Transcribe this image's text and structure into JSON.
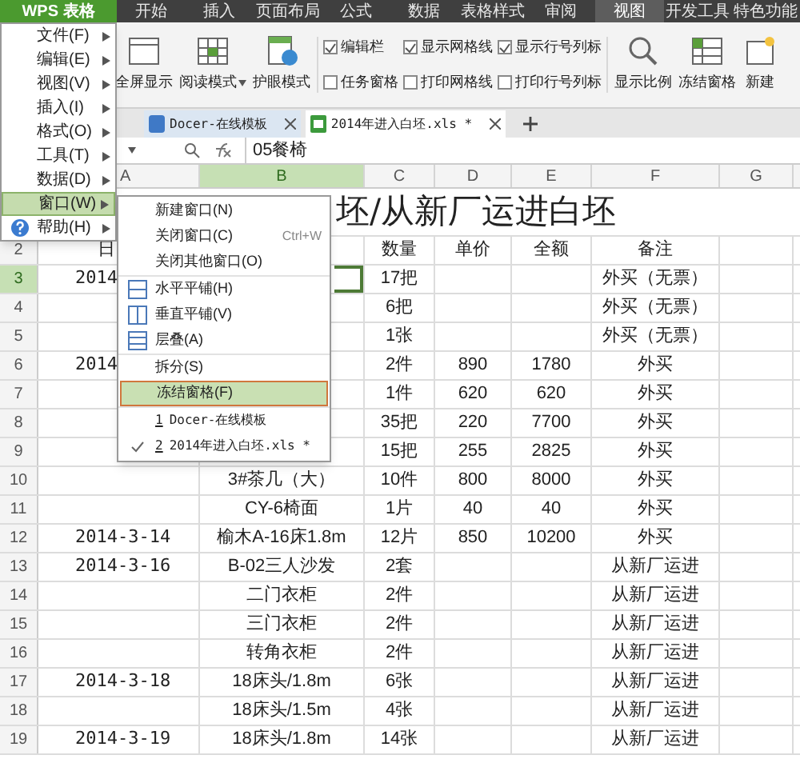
{
  "app_menu": {
    "label": "WPS 表格",
    "items": [
      {
        "label": "文件(F)",
        "kind": "plain",
        "selected": false
      },
      {
        "label": "编辑(E)",
        "kind": "plain",
        "selected": false
      },
      {
        "label": "视图(V)",
        "kind": "plain",
        "selected": false
      },
      {
        "label": "插入(I)",
        "kind": "plain",
        "selected": false
      },
      {
        "label": "格式(O)",
        "kind": "plain",
        "selected": false
      },
      {
        "label": "工具(T)",
        "kind": "plain",
        "selected": false
      },
      {
        "label": "数据(D)",
        "kind": "plain",
        "selected": false
      },
      {
        "label": "窗口(W)",
        "kind": "plain",
        "selected": true
      },
      {
        "label": "帮助(H)",
        "kind": "help",
        "selected": false
      }
    ]
  },
  "tabs": [
    {
      "label": "开始",
      "selected": false
    },
    {
      "label": "插入",
      "selected": false
    },
    {
      "label": "页面布局",
      "selected": false
    },
    {
      "label": "公式",
      "selected": false
    },
    {
      "label": "数据",
      "selected": false
    },
    {
      "label": "表格样式",
      "selected": false
    },
    {
      "label": "审阅",
      "selected": false
    },
    {
      "label": "视图",
      "selected": true
    },
    {
      "label": "开发工具",
      "selected": false
    },
    {
      "label": "特色功能",
      "selected": false
    }
  ],
  "ribbon": {
    "buttons_left": [
      {
        "label": "全屏显示",
        "kind": "fullscreen"
      },
      {
        "label": "阅读模式",
        "kind": "read"
      },
      {
        "label": "护眼模式",
        "kind": "eye"
      }
    ],
    "checkboxes": [
      {
        "label": "编辑栏",
        "checked": true
      },
      {
        "label": "任务窗格",
        "checked": false
      },
      {
        "label": "显示网格线",
        "checked": true
      },
      {
        "label": "打印网格线",
        "checked": false
      },
      {
        "label": "显示行号列标",
        "checked": true
      },
      {
        "label": "打印行号列标",
        "checked": false
      }
    ],
    "buttons_right": [
      {
        "label": "显示比例",
        "kind": "zoom"
      },
      {
        "label": "冻结窗格",
        "kind": "freeze"
      },
      {
        "label": "新建",
        "kind": "new"
      }
    ]
  },
  "documents": [
    {
      "label": "Docer-在线模板",
      "kind": "docer",
      "selected": false
    },
    {
      "label": "2014年进入白坯.xls *",
      "kind": "sheet",
      "selected": true
    }
  ],
  "formula_bar": {
    "value": "05餐椅"
  },
  "columns": [
    {
      "label": "A",
      "selected": false
    },
    {
      "label": "B",
      "selected": true
    },
    {
      "label": "C",
      "selected": false
    },
    {
      "label": "D",
      "selected": false
    },
    {
      "label": "E",
      "selected": false
    },
    {
      "label": "F",
      "selected": false
    },
    {
      "label": "G",
      "selected": false
    }
  ],
  "title_row": {
    "title": "坯/从新厂运进白坯"
  },
  "rows": [
    {
      "header": "2",
      "kind": "head",
      "selected": false,
      "cells": {
        "A": "日",
        "C": "数量",
        "D": "单价",
        "E": "全额",
        "F": "备注"
      }
    },
    {
      "header": "3",
      "kind": "data",
      "selected": true,
      "cells": {
        "A": "2014",
        "C": "17把",
        "F": "外买（无票）"
      }
    },
    {
      "header": "4",
      "kind": "data",
      "selected": false,
      "cells": {
        "C": "6把",
        "F": "外买（无票）"
      }
    },
    {
      "header": "5",
      "kind": "data",
      "selected": false,
      "cells": {
        "C": "1张",
        "F": "外买（无票）"
      }
    },
    {
      "header": "6",
      "kind": "data",
      "selected": false,
      "cells": {
        "A": "2014",
        "C": "2件",
        "D": "890",
        "E": "1780",
        "F": "外买"
      }
    },
    {
      "header": "7",
      "kind": "data",
      "selected": false,
      "cells": {
        "C": "1件",
        "D": "620",
        "E": "620",
        "F": "外买"
      }
    },
    {
      "header": "8",
      "kind": "data",
      "selected": false,
      "cells": {
        "C": "35把",
        "D": "220",
        "E": "7700",
        "F": "外买"
      }
    },
    {
      "header": "9",
      "kind": "data",
      "selected": false,
      "cells": {
        "C": "15把",
        "D": "255",
        "E": "2825",
        "F": "外买"
      }
    },
    {
      "header": "10",
      "kind": "data",
      "selected": false,
      "cells": {
        "B": "3#茶几（大）",
        "C": "10件",
        "D": "800",
        "E": "8000",
        "F": "外买"
      }
    },
    {
      "header": "11",
      "kind": "data",
      "selected": false,
      "cells": {
        "B": "CY-6椅面",
        "C": "1片",
        "D": "40",
        "E": "40",
        "F": "外买"
      }
    },
    {
      "header": "12",
      "kind": "data",
      "selected": false,
      "cells": {
        "A": "2014-3-14",
        "B": "榆木A-16床1.8m",
        "C": "12片",
        "D": "850",
        "E": "10200",
        "F": "外买"
      }
    },
    {
      "header": "13",
      "kind": "data",
      "selected": false,
      "cells": {
        "A": "2014-3-16",
        "B": "B-02三人沙发",
        "C": "2套",
        "F": "从新厂运进"
      }
    },
    {
      "header": "14",
      "kind": "data",
      "selected": false,
      "cells": {
        "B": "二门衣柜",
        "C": "2件",
        "F": "从新厂运进"
      }
    },
    {
      "header": "15",
      "kind": "data",
      "selected": false,
      "cells": {
        "B": "三门衣柜",
        "C": "2件",
        "F": "从新厂运进"
      }
    },
    {
      "header": "16",
      "kind": "data",
      "selected": false,
      "cells": {
        "B": "转角衣柜",
        "C": "2件",
        "F": "从新厂运进"
      }
    },
    {
      "header": "17",
      "kind": "data",
      "selected": false,
      "cells": {
        "A": "2014-3-18",
        "B": "18床头/1.8m",
        "C": "6张",
        "F": "从新厂运进"
      }
    },
    {
      "header": "18",
      "kind": "data",
      "selected": false,
      "cells": {
        "B": "18床头/1.5m",
        "C": "4张",
        "F": "从新厂运进"
      }
    },
    {
      "header": "19",
      "kind": "data",
      "selected": false,
      "cells": {
        "A": "2014-3-19",
        "B": "18床头/1.8m",
        "C": "14张",
        "F": "从新厂运进"
      }
    }
  ],
  "window_menu": {
    "groups": [
      [
        {
          "label": "新建窗口(N)",
          "kind": "plain",
          "selected": false
        },
        {
          "label": "关闭窗口(C)",
          "kind": "plain",
          "shortcut": "Ctrl+W",
          "selected": false
        },
        {
          "label": "关闭其他窗口(O)",
          "kind": "plain",
          "selected": false
        }
      ],
      [
        {
          "label": "水平平铺(H)",
          "kind": "tile-horizontal",
          "selected": false
        },
        {
          "label": "垂直平铺(V)",
          "kind": "tile-vertical",
          "selected": false
        },
        {
          "label": "层叠(A)",
          "kind": "cascade",
          "selected": false
        }
      ],
      [
        {
          "label": "拆分(S)",
          "kind": "plain",
          "selected": false
        },
        {
          "label": "冻结窗格(F)",
          "kind": "plain",
          "selected": true
        }
      ],
      [
        {
          "number": "1",
          "label": "Docer-在线模板",
          "kind": "recent",
          "checked": false,
          "selected": false
        },
        {
          "number": "2",
          "label": "2014年进入白坯.xls *",
          "kind": "recent",
          "checked": true,
          "selected": false
        }
      ]
    ]
  }
}
